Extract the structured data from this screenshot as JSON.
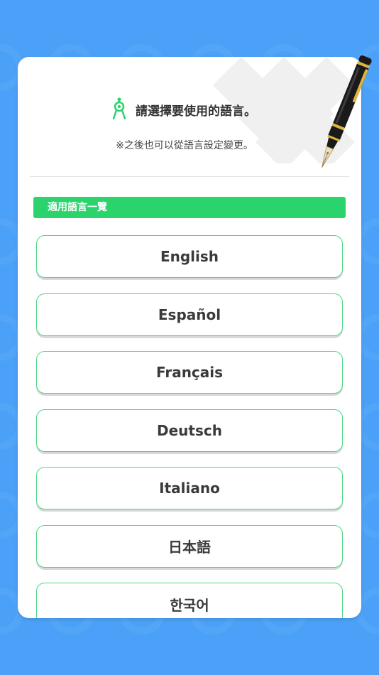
{
  "colors": {
    "background": "#4ba1f7",
    "accent_green": "#2bd36d",
    "button_border": "#4cd684",
    "card": "#ffffff"
  },
  "header": {
    "icon": "compass-icon",
    "title": "請選擇要使用的語言。",
    "subtitle": "※之後也可以從語言設定變更。"
  },
  "section": {
    "label": "適用語言一覽"
  },
  "languages": [
    {
      "label": "English"
    },
    {
      "label": "Español"
    },
    {
      "label": "Français"
    },
    {
      "label": "Deutsch"
    },
    {
      "label": "Italiano"
    },
    {
      "label": "日本語"
    },
    {
      "label": "한국어"
    }
  ]
}
